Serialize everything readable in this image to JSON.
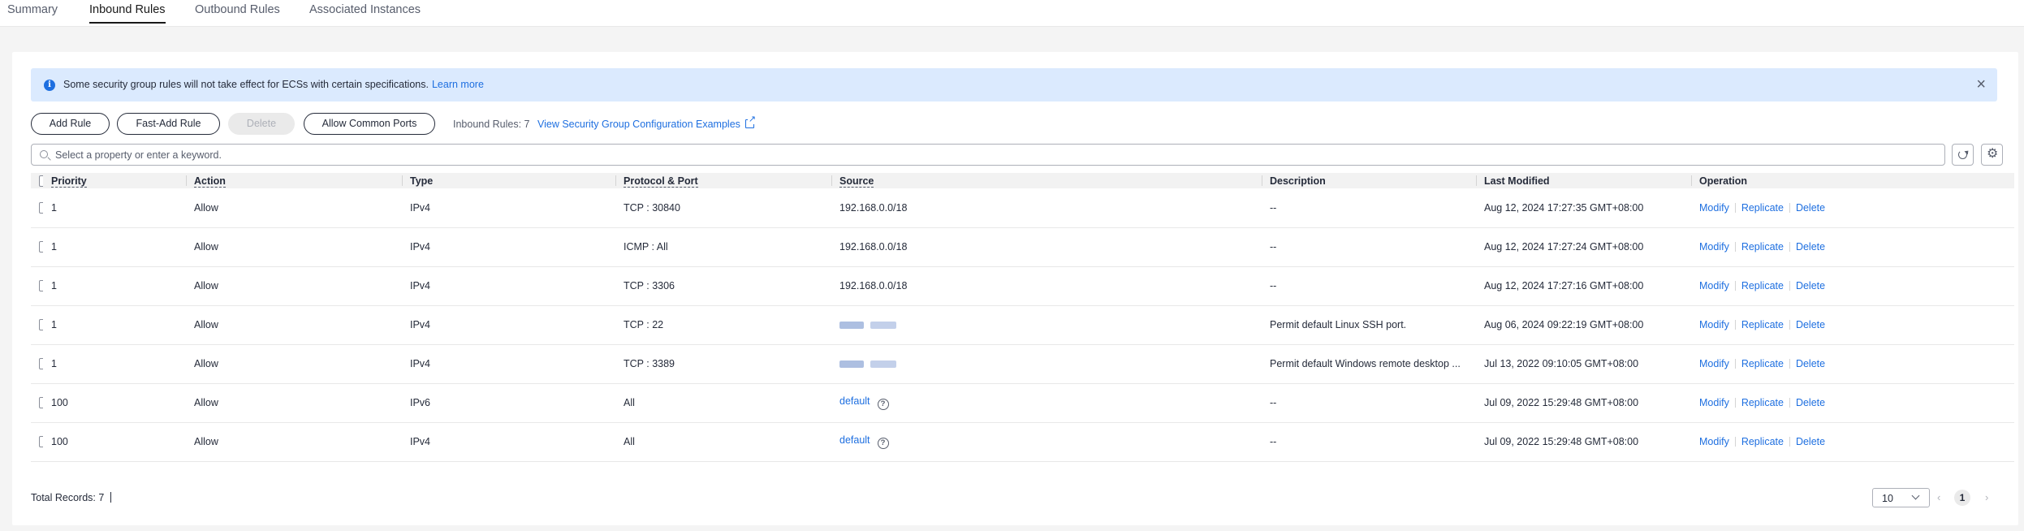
{
  "tabs": [
    {
      "label": "Summary"
    },
    {
      "label": "Inbound Rules",
      "active": true
    },
    {
      "label": "Outbound Rules"
    },
    {
      "label": "Associated Instances"
    }
  ],
  "alert": {
    "message": "Some security group rules will not take effect for ECSs with certain specifications.",
    "link": "Learn more",
    "close_icon": "close-icon",
    "icon": "info-icon"
  },
  "toolbar": {
    "add_rule": "Add Rule",
    "fast_add_rule": "Fast-Add Rule",
    "delete": "Delete",
    "allow_common_ports": "Allow Common Ports",
    "rule_count": "Inbound Rules: 7",
    "examples_link": "View Security Group Configuration Examples"
  },
  "search": {
    "placeholder": "Select a property or enter a keyword."
  },
  "table": {
    "headers": {
      "priority": "Priority",
      "action": "Action",
      "type": "Type",
      "protocol_port": "Protocol & Port",
      "source": "Source",
      "description": "Description",
      "last_modified": "Last Modified",
      "operation": "Operation"
    },
    "rows": [
      {
        "priority": "1",
        "action": "Allow",
        "type": "IPv4",
        "protocol_port": "TCP : 30840",
        "source": "192.168.0.0/18",
        "description": "--",
        "last_modified": "Aug 12, 2024 17:27:35 GMT+08:00"
      },
      {
        "priority": "1",
        "action": "Allow",
        "type": "IPv4",
        "protocol_port": "ICMP : All",
        "source": "192.168.0.0/18",
        "description": "--",
        "last_modified": "Aug 12, 2024 17:27:24 GMT+08:00"
      },
      {
        "priority": "1",
        "action": "Allow",
        "type": "IPv4",
        "protocol_port": "TCP : 3306",
        "source": "192.168.0.0/18",
        "description": "--",
        "last_modified": "Aug 12, 2024 17:27:16 GMT+08:00"
      },
      {
        "priority": "1",
        "action": "Allow",
        "type": "IPv4",
        "protocol_port": "TCP : 22",
        "source": "",
        "source_redacted": true,
        "description": "Permit default Linux SSH port.",
        "last_modified": "Aug 06, 2024 09:22:19 GMT+08:00"
      },
      {
        "priority": "1",
        "action": "Allow",
        "type": "IPv4",
        "protocol_port": "TCP : 3389",
        "source": "",
        "source_redacted": true,
        "description": "Permit default Windows remote desktop ...",
        "last_modified": "Jul 13, 2022 09:10:05 GMT+08:00"
      },
      {
        "priority": "100",
        "action": "Allow",
        "type": "IPv6",
        "protocol_port": "All",
        "source": "default",
        "source_link": true,
        "description": "--",
        "last_modified": "Jul 09, 2022 15:29:48 GMT+08:00"
      },
      {
        "priority": "100",
        "action": "Allow",
        "type": "IPv4",
        "protocol_port": "All",
        "source": "default",
        "source_link": true,
        "description": "--",
        "last_modified": "Jul 09, 2022 15:29:48 GMT+08:00"
      }
    ],
    "operations": {
      "modify": "Modify",
      "replicate": "Replicate",
      "delete": "Delete"
    }
  },
  "footer": {
    "total": "Total Records: 7",
    "page_size": "10",
    "current_page": "1"
  },
  "colors": {
    "link": "#1e6fe0",
    "alert_bg": "#dbeafe",
    "header_bg": "#f2f2f2"
  }
}
